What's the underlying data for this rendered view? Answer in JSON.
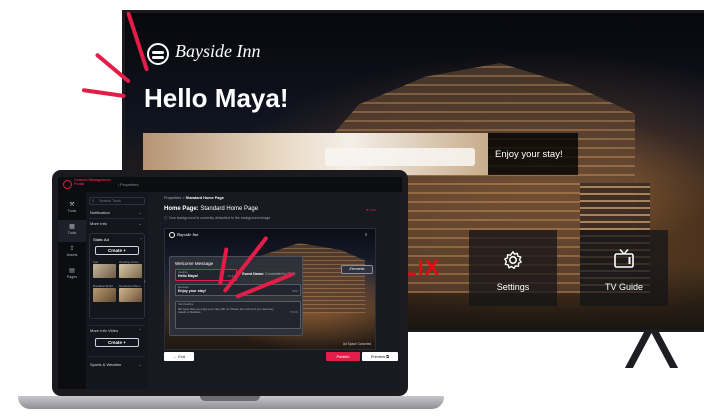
{
  "tv": {
    "brand": "Bayside Inn",
    "greeting": "Hello Maya!",
    "banner_text": "Enjoy your stay!",
    "partial_netflix": "LIX",
    "tiles": [
      {
        "label": "Settings",
        "icon": "gear-icon"
      },
      {
        "label": "TV Guide",
        "icon": "tv-icon"
      }
    ]
  },
  "app": {
    "logo_text": "Content Management Portal",
    "top_crumb": "/ Properties",
    "rail": [
      {
        "label": "Tools",
        "icon": "tools-icon"
      },
      {
        "label": "Tools",
        "icon": "grid-icon"
      },
      {
        "label": "Assets",
        "icon": "upload-icon"
      },
      {
        "label": "Pages",
        "icon": "page-icon"
      }
    ],
    "panel": {
      "search_placeholder": "Search Tools",
      "sections": [
        "Notification",
        "More Info",
        "Static Ad"
      ],
      "create_label": "Create +",
      "thumbs": [
        "Spa",
        "Wedding Venue",
        "Breakfast Buffet",
        "Restaurant Menu"
      ],
      "video_section": "More Info Video",
      "create_label_2": "Create +",
      "bottom_section": "Sports & Weather"
    },
    "main": {
      "crumb_parent": "Properties",
      "crumb_current": "Standard Home Page",
      "title_prefix": "Home Page:",
      "title_name": "Standard Home Page",
      "live": "● Live",
      "info": "ⓘ Your background is currently defaulted to the background image",
      "preview": {
        "brand": "Bayside Inn",
        "card_title": "Welcome Message",
        "heading_label": "Heading",
        "heading_value": "Hello Maya!",
        "heading_count": "11/40",
        "guest_name_label": "Guest Name:",
        "guest_name_value": "Connected to PMS",
        "message_label": "Message",
        "message_value": "Enjoy your stay!",
        "message_count": "16/50",
        "sub_label": "Sub-headline",
        "sub_value": "We hope that you enjoy your stay with us. Please let us know if you need any towels or blankets.",
        "sub_count": "87/100",
        "elements_btn": "Elements",
        "ad_space": "Ad Space Canceled"
      },
      "exit": "← Exit",
      "publish": "Publish",
      "preview_btn": "Preview ⧉"
    }
  },
  "colors": {
    "accent": "#e11d48",
    "dark_bg": "#171a21"
  }
}
